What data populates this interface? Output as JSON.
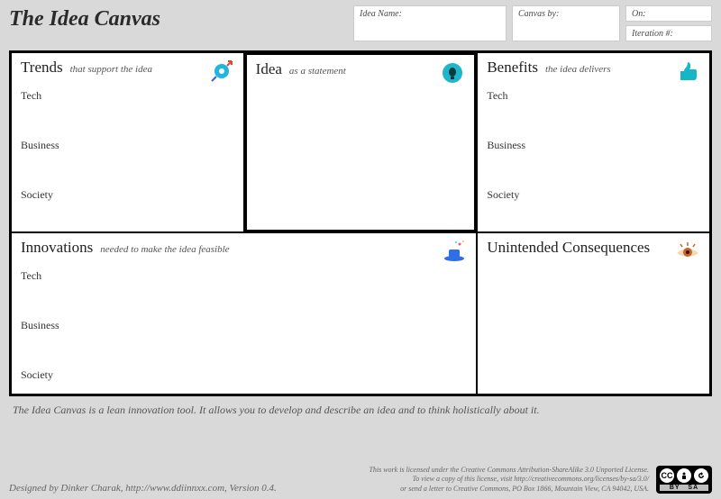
{
  "title": "The Idea Canvas",
  "meta": {
    "idea_name_label": "Idea Name:",
    "canvas_by_label": "Canvas by:",
    "on_label": "On:",
    "iteration_label": "Iteration #:"
  },
  "cells": {
    "trends": {
      "title": "Trends",
      "sub": "that support the idea"
    },
    "idea": {
      "title": "Idea",
      "sub": "as a statement"
    },
    "benefits": {
      "title": "Benefits",
      "sub": "the idea delivers"
    },
    "innovations": {
      "title": "Innovations",
      "sub": "needed to make the idea feasible"
    },
    "consequences": {
      "title": "Unintended Consequences",
      "sub": ""
    }
  },
  "categories": {
    "tech": "Tech",
    "business": "Business",
    "society": "Society"
  },
  "footer_note": "The Idea Canvas is a lean innovation tool. It allows you to develop and describe an idea and to think holistically about it.",
  "credit": "Designed by Dinker Charak, http://www.ddiinnxx.com, Version 0.4.",
  "license": {
    "l1": "This work is licensed under the Creative Commons Attribution-ShareAlike 3.0 Unported License.",
    "l2": "To view a copy of this license, visit http://creativecommons.org/licenses/by-sa/3.0/",
    "l3": "or send a letter to Creative Commons, PO Box 1866, Mountain View, CA 94042, USA.",
    "cc": "CC",
    "by": "BY",
    "sa": "SA"
  }
}
